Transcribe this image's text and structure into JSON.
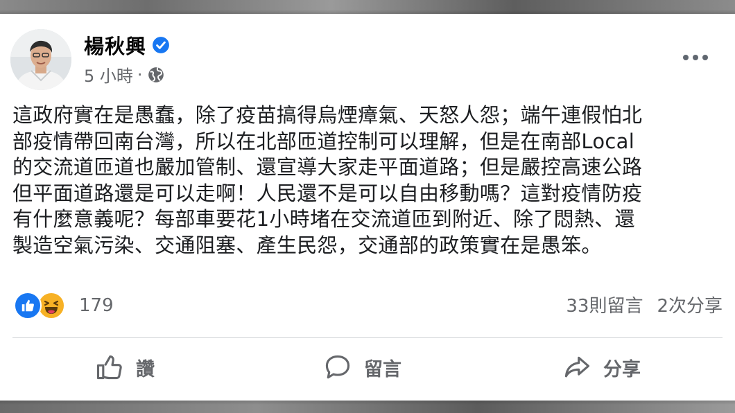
{
  "post": {
    "author": "楊秋興",
    "time": "5 小時",
    "time_separator": "·",
    "body_lines": [
      "這政府實在是愚蠢，除了疫苗搞得烏煙瘴氣、天怒人怨；端午連假怕北",
      "部疫情帶回南台灣，所以在北部匝道控制可以理解，但是在南部Local",
      "的交流道匝道也嚴加管制、還宣導大家走平面道路；但是嚴控高速公路",
      "但平面道路還是可以走啊！人民還不是可以自由移動嗎？這對疫情防疫",
      "有什麼意義呢？每部車要花1小時堵在交流道匝到附近、除了悶熱、還",
      "製造空氣污染、交通阻塞、產生民怨，交通部的政策實在是愚笨。"
    ],
    "reactions": {
      "count": "179",
      "types": [
        "like-icon",
        "haha-icon"
      ]
    },
    "comments": "33則留言",
    "shares": "2次分享"
  },
  "actions": {
    "like": "讚",
    "comment": "留言",
    "share": "分享"
  },
  "colors": {
    "accent": "#1877f2",
    "haha": "#f7b125",
    "secondary_text": "#65676b"
  }
}
